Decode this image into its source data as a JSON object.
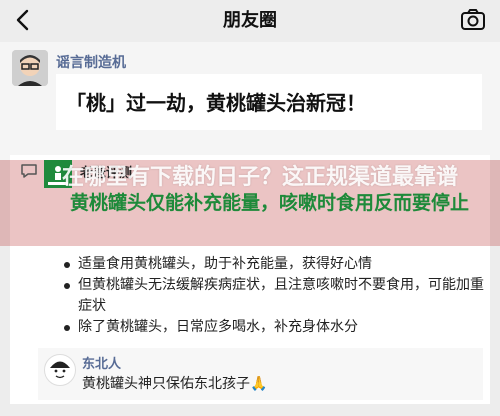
{
  "nav": {
    "title": "朋友圈"
  },
  "post": {
    "author": "谣言制造机",
    "headline": "「桃」过一劫，黄桃罐头治新冠！"
  },
  "comment": {
    "author": "老爸评测",
    "logo_text": "老爸评测",
    "green_headline": "黄桃罐头仅能补充能量，咳嗽时食用反而要停止",
    "overlay_text": "在哪里有下载的日子？这正规渠道最靠谱",
    "bullets": [
      "适量食用黄桃罐头，助于补充能量，获得好心情",
      "但黄桃罐头无法缓解疾病症状，且注意咳嗽时不要食用，可能加重症状",
      "除了黄桃罐头，日常应多喝水，补充身体水分"
    ]
  },
  "reply": {
    "author": "东北人",
    "text": "黄桃罐头神只保佑东北孩子🙏"
  },
  "colors": {
    "name_blue": "#576b95",
    "green": "#1e8a3a",
    "overlay_red": "#be3c3c"
  }
}
